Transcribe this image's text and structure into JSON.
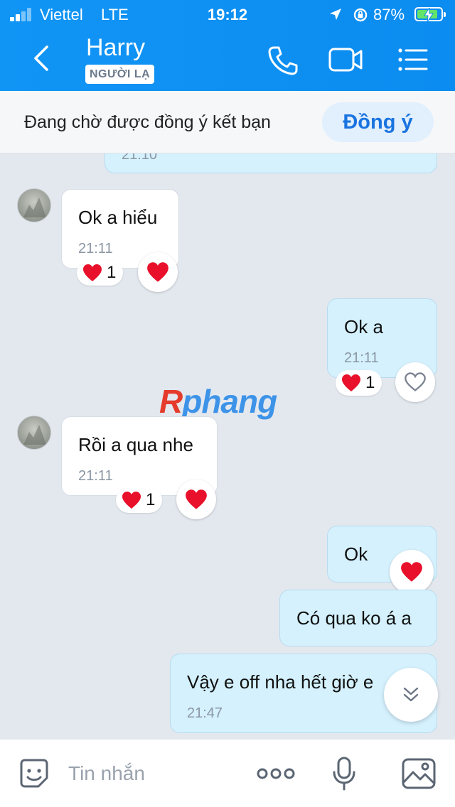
{
  "status_bar": {
    "carrier": "Viettel",
    "network": "LTE",
    "time": "19:12",
    "battery": "87%",
    "battery_level": 0.87
  },
  "header": {
    "contact_name": "Harry",
    "stranger_badge": "NGƯỜI LẠ"
  },
  "friend_request": {
    "text": "Đang chờ được đồng ý kết bạn",
    "accept_label": "Đồng ý"
  },
  "messages": [
    {
      "direction": "out",
      "text": "",
      "time": "21:10"
    },
    {
      "direction": "in",
      "text": "Ok a hiểu",
      "time": "21:11",
      "reaction_count": "1"
    },
    {
      "direction": "out",
      "text": "Ok a",
      "time": "21:11",
      "reaction_count": "1"
    },
    {
      "direction": "in",
      "text": "Rồi a qua nhe",
      "time": "21:11",
      "reaction_count": "1"
    },
    {
      "direction": "out",
      "text": "Ok"
    },
    {
      "direction": "out",
      "text": "Có qua ko á a"
    },
    {
      "direction": "out",
      "text": "Vậy e off nha hết giờ e",
      "time": "21:47"
    }
  ],
  "watermark": {
    "first_letter": "R",
    "rest": "phang"
  },
  "input": {
    "placeholder": "Tin nhắn"
  },
  "colors": {
    "header_blue": "#0b8cf0",
    "heart_red": "#e8102b",
    "accept_text": "#1a74e0",
    "outgoing_bubble": "#d4f1fd"
  },
  "icons": [
    "back-icon",
    "phone-icon",
    "video-icon",
    "menu-icon",
    "heart-icon",
    "heart-outline-icon",
    "chevron-double-down-icon",
    "sticker-icon",
    "more-icon",
    "microphone-icon",
    "image-icon"
  ]
}
